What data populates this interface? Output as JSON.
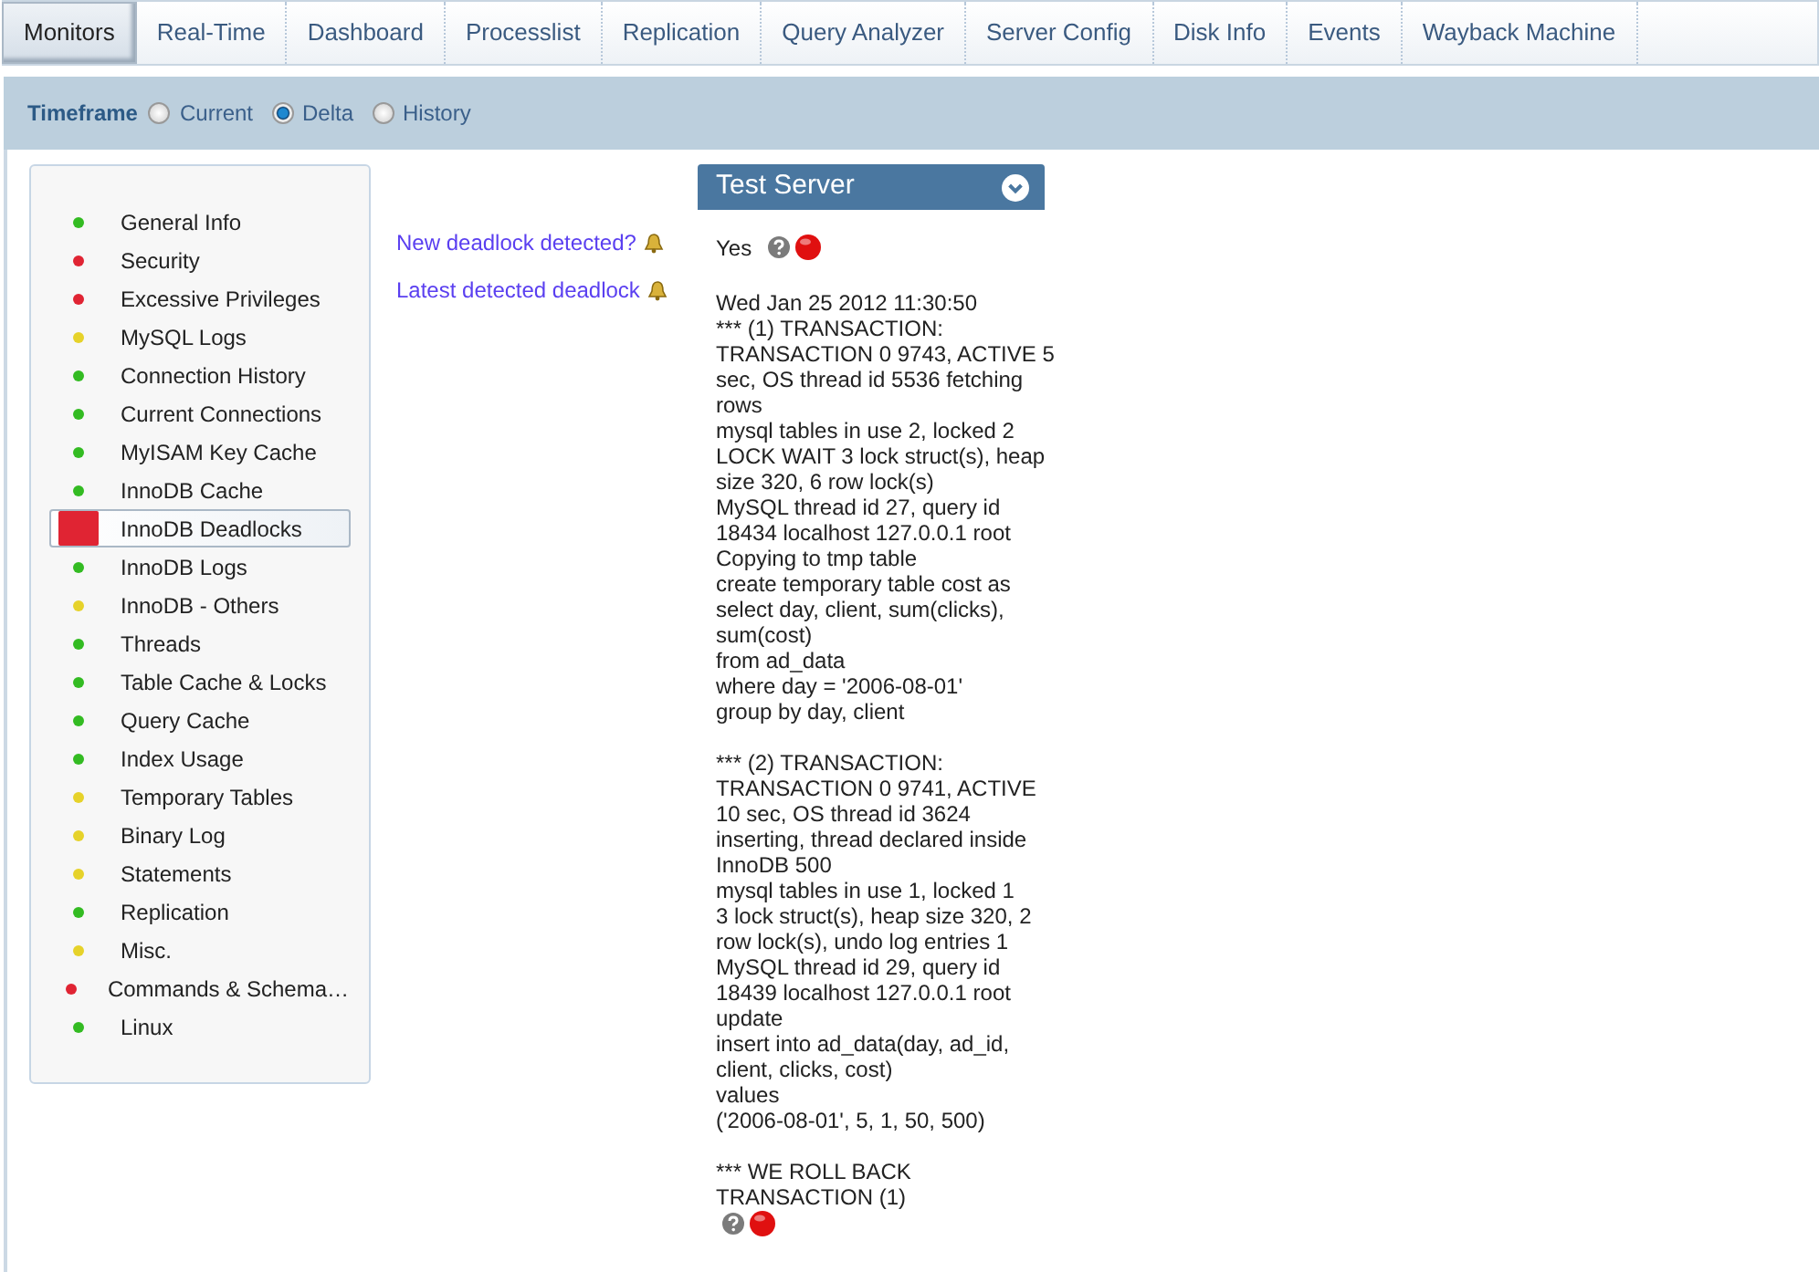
{
  "tabs": [
    {
      "label": "Monitors",
      "selected": true
    },
    {
      "label": "Real-Time",
      "selected": false
    },
    {
      "label": "Dashboard",
      "selected": false
    },
    {
      "label": "Processlist",
      "selected": false
    },
    {
      "label": "Replication",
      "selected": false
    },
    {
      "label": "Query Analyzer",
      "selected": false
    },
    {
      "label": "Server Config",
      "selected": false
    },
    {
      "label": "Disk Info",
      "selected": false
    },
    {
      "label": "Events",
      "selected": false
    },
    {
      "label": "Wayback Machine",
      "selected": false
    }
  ],
  "timeframe": {
    "label": "Timeframe",
    "options": [
      {
        "label": "Current",
        "selected": false
      },
      {
        "label": "Delta",
        "selected": true
      },
      {
        "label": "History",
        "selected": false
      }
    ]
  },
  "sidebar": {
    "items": [
      {
        "label": "General Info",
        "color": "#33bb22",
        "selected": false
      },
      {
        "label": "Security",
        "color": "#e02433",
        "selected": false
      },
      {
        "label": "Excessive Privileges",
        "color": "#e02433",
        "selected": false
      },
      {
        "label": "MySQL Logs",
        "color": "#e6d22a",
        "selected": false
      },
      {
        "label": "Connection History",
        "color": "#33bb22",
        "selected": false
      },
      {
        "label": "Current Connections",
        "color": "#33bb22",
        "selected": false
      },
      {
        "label": "MyISAM Key Cache",
        "color": "#33bb22",
        "selected": false
      },
      {
        "label": "InnoDB Cache",
        "color": "#33bb22",
        "selected": false
      },
      {
        "label": "InnoDB Deadlocks",
        "color": "#e02433",
        "selected": true
      },
      {
        "label": "InnoDB Logs",
        "color": "#33bb22",
        "selected": false
      },
      {
        "label": "InnoDB - Others",
        "color": "#e6d22a",
        "selected": false
      },
      {
        "label": "Threads",
        "color": "#33bb22",
        "selected": false
      },
      {
        "label": "Table Cache & Locks",
        "color": "#33bb22",
        "selected": false
      },
      {
        "label": "Query Cache",
        "color": "#33bb22",
        "selected": false
      },
      {
        "label": "Index Usage",
        "color": "#33bb22",
        "selected": false
      },
      {
        "label": "Temporary Tables",
        "color": "#e6d22a",
        "selected": false
      },
      {
        "label": "Binary Log",
        "color": "#e6d22a",
        "selected": false
      },
      {
        "label": "Statements",
        "color": "#e6d22a",
        "selected": false
      },
      {
        "label": "Replication",
        "color": "#33bb22",
        "selected": false
      },
      {
        "label": "Misc.",
        "color": "#e6d22a",
        "selected": false
      },
      {
        "label": "Commands & Schema…",
        "color": "#e02433",
        "selected": false
      },
      {
        "label": "Linux",
        "color": "#33bb22",
        "selected": false
      }
    ]
  },
  "metrics": [
    {
      "label": "New deadlock detected?"
    },
    {
      "label": "Latest detected deadlock"
    }
  ],
  "server_panel": {
    "title": "Test Server",
    "new_deadlock": {
      "value": "Yes",
      "alert": true
    },
    "latest_deadlock": {
      "alert": true,
      "blocks": [
        [
          "Wed Jan 25 2012 11:30:50",
          "*** (1) TRANSACTION:",
          "TRANSACTION 0 9743, ACTIVE 5",
          "sec, OS thread id 5536 fetching",
          "rows",
          "mysql tables in use 2, locked 2",
          "LOCK WAIT 3 lock struct(s), heap",
          "size 320, 6 row lock(s)",
          "MySQL thread id 27, query id",
          "18434 localhost 127.0.0.1 root",
          "Copying to tmp table",
          "create temporary table cost as",
          "select day, client, sum(clicks),",
          "sum(cost)",
          "from ad_data",
          "where day = '2006-08-01'",
          "group by day, client"
        ],
        [
          "*** (2) TRANSACTION:",
          "TRANSACTION 0 9741, ACTIVE",
          "10 sec, OS thread id 3624",
          "inserting, thread declared inside",
          "InnoDB 500",
          "mysql tables in use 1, locked 1",
          "3 lock struct(s), heap size 320, 2",
          "row lock(s), undo log entries 1",
          "MySQL thread id 29, query id",
          "18439 localhost 127.0.0.1 root",
          "update",
          "insert into ad_data(day, ad_id,",
          "client, clicks, cost)",
          "values",
          "('2006-08-01', 5, 1, 50, 500)"
        ],
        [
          "*** WE ROLL BACK",
          "TRANSACTION (1)"
        ]
      ]
    }
  }
}
